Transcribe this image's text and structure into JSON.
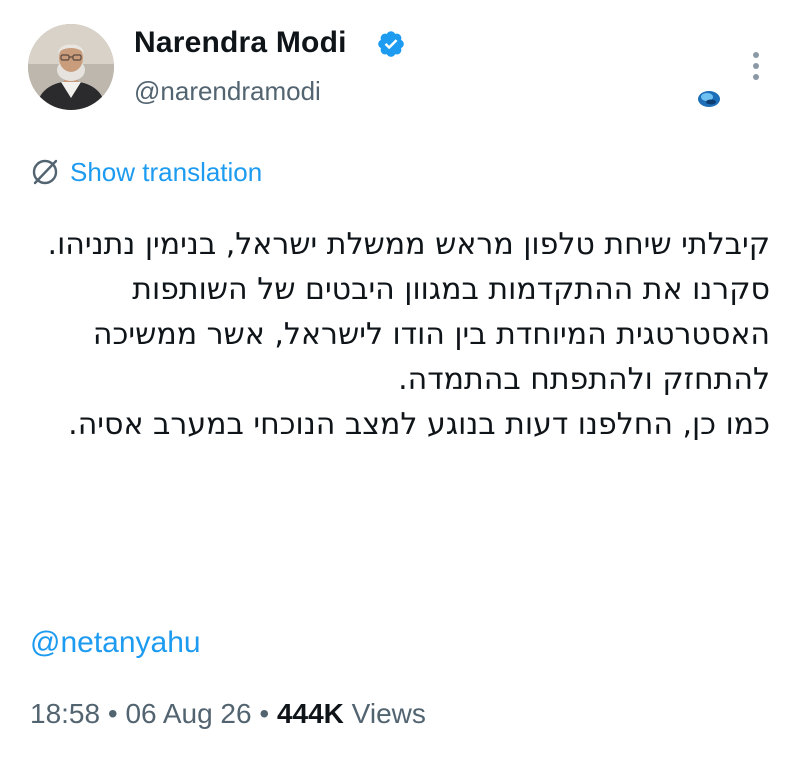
{
  "author": {
    "display_name": "Narendra Modi",
    "handle": "@narendramodi",
    "verified": true,
    "verified_color": "#1d9bf0"
  },
  "header_icons": {
    "more": "more-vertical-icon",
    "grok": "grok-icon"
  },
  "translation": {
    "icon": "globe-slash-icon",
    "label": "Show translation"
  },
  "tweet": {
    "paragraph_1": "קיבלתי שיחת טלפון מראש ממשלת ישראל, בנימין נתניהו. סקרנו את ההתקדמות במגוון היבטים של השותפות האסטרטגית המיוחדת בין הודו לישראל, אשר ממשיכה להתחזק ולהתפתח בהתמדה.",
    "paragraph_2": "כמו כן, החלפנו דעות בנוגע למצב הנוכחי במערב אסיה.",
    "mention": "@netanyahu"
  },
  "meta": {
    "time": "18:58",
    "separator": "•",
    "date": "06 Aug 26",
    "views_count": "444K",
    "views_label": "Views"
  },
  "colors": {
    "link": "#1d9bf0",
    "secondary_text": "#536471",
    "primary_text": "#0f1419"
  }
}
